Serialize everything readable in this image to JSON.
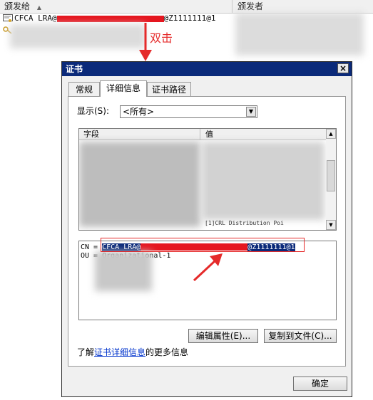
{
  "background": {
    "columns": [
      "颁发给",
      "颁发者"
    ],
    "row1_prefix": "CFCA LRA@",
    "row1_suffix": "@Z1111111@1"
  },
  "annotations": {
    "double_click": "双击"
  },
  "dialog": {
    "title": "证书",
    "close": "×",
    "tabs": [
      {
        "label": "常规"
      },
      {
        "label": "详细信息"
      },
      {
        "label": "证书路径"
      }
    ],
    "show_label": "显示(S):",
    "show_value": "<所有>",
    "list_headers": [
      "字段",
      "值"
    ],
    "list_value_fragment": "[1]CRL Distribution Poi",
    "value_line1_label": "CN = ",
    "value_line1_prefix": "CFCA LRA@",
    "value_line1_suffix": "@Z1111111@1",
    "value_line2_label": "OU = ",
    "value_line2_text": "Organizational-1",
    "edit_button": "编辑属性(E)...",
    "copy_button": "复制到文件(C)...",
    "more_info_prefix": "了解",
    "more_info_link": "证书详细信息",
    "more_info_suffix": "的更多信息",
    "ok_button": "确定"
  },
  "colors": {
    "titlebar": "#0b2a7a",
    "annotation_red": "#e52a2a",
    "redaction": "#e5161f"
  }
}
